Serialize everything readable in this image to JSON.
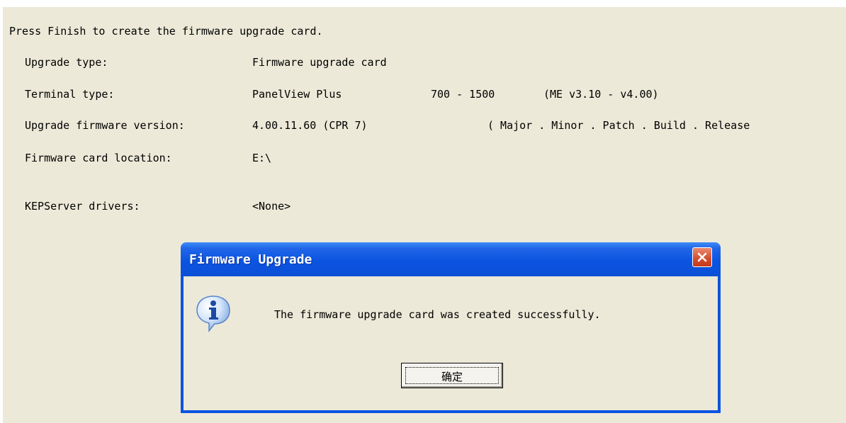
{
  "wizard": {
    "intro": "Press Finish to create the firmware upgrade card.",
    "upgrade_type_label": "Upgrade type:",
    "upgrade_type_value": "Firmware upgrade card",
    "terminal_type_label": "Terminal type:",
    "terminal_type_model": "PanelView Plus",
    "terminal_type_range": "700 - 1500",
    "terminal_type_me": "(ME v3.10 - v4.00)",
    "firmware_version_label": "Upgrade firmware version:",
    "firmware_version_value": "4.00.11.60 (CPR 7)",
    "firmware_version_format": "( Major . Minor . Patch . Build . Release",
    "card_location_label": "Firmware card location:",
    "card_location_value": "E:\\",
    "kepserver_label": "KEPServer drivers:",
    "kepserver_value": "<None>"
  },
  "dialog": {
    "title": "Firmware Upgrade",
    "message": "The firmware upgrade card was created successfully.",
    "ok_label": "确定",
    "icon": "info-icon"
  },
  "colors": {
    "panel_bg": "#ece9d8",
    "titlebar": "#0b54e1",
    "close_button": "#d54b2b"
  }
}
